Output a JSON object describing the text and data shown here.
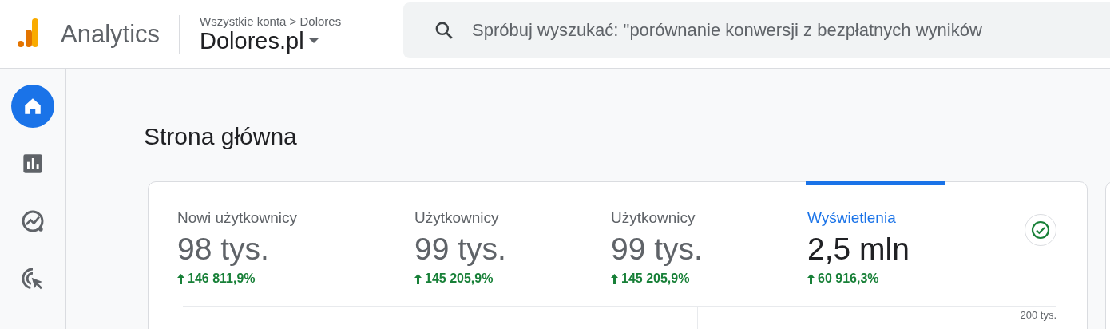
{
  "header": {
    "product": "Analytics",
    "breadcrumb": "Wszystkie konta > Dolores",
    "property": "Dolores.pl",
    "search": {
      "placeholder": "Spróbuj wyszukać: \"porównanie konwersji z bezpłatnych wyników"
    }
  },
  "sidebar": {
    "items": [
      {
        "kind": "home",
        "selected": true
      },
      {
        "kind": "reports",
        "selected": false
      },
      {
        "kind": "explore",
        "selected": false
      },
      {
        "kind": "advertising",
        "selected": false
      }
    ]
  },
  "page": {
    "title": "Strona główna"
  },
  "metrics": [
    {
      "label": "Nowi użytkownicy",
      "value": "98 tys.",
      "change": "146 811,9%",
      "selected": false
    },
    {
      "label": "Użytkownicy",
      "value": "99 tys.",
      "change": "145 205,9%",
      "selected": false
    },
    {
      "label": "Użytkownicy",
      "value": "99 tys.",
      "change": "145 205,9%",
      "selected": false
    },
    {
      "label": "Wyświetlenia",
      "value": "2,5 mln",
      "change": "60 916,3%",
      "selected": true
    }
  ],
  "chart": {
    "axis_label": "200 tys."
  }
}
